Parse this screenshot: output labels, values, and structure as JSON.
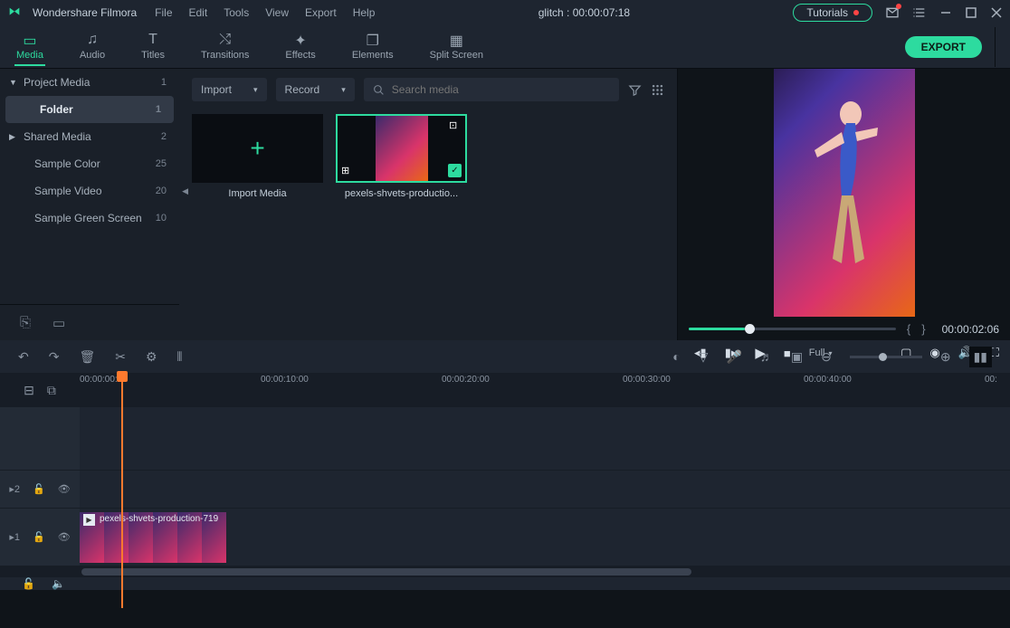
{
  "app_title": "Wondershare Filmora",
  "menu": [
    "File",
    "Edit",
    "Tools",
    "View",
    "Export",
    "Help"
  ],
  "project_title": "glitch : 00:00:07:18",
  "tutorials_label": "Tutorials",
  "tool_tabs": [
    {
      "label": "Media",
      "icon": "folder"
    },
    {
      "label": "Audio",
      "icon": "music"
    },
    {
      "label": "Titles",
      "icon": "text"
    },
    {
      "label": "Transitions",
      "icon": "trans"
    },
    {
      "label": "Effects",
      "icon": "fx"
    },
    {
      "label": "Elements",
      "icon": "elem"
    },
    {
      "label": "Split Screen",
      "icon": "split"
    }
  ],
  "export_label": "EXPORT",
  "sidebar_items": [
    {
      "label": "Project Media",
      "count": "1",
      "arrow": "▼",
      "indent": false
    },
    {
      "label": "Folder",
      "count": "1",
      "indent": true,
      "active": true
    },
    {
      "label": "Shared Media",
      "count": "2",
      "arrow": "▶",
      "indent": false
    },
    {
      "label": "Sample Color",
      "count": "25",
      "indent": true
    },
    {
      "label": "Sample Video",
      "count": "20",
      "indent": true
    },
    {
      "label": "Sample Green Screen",
      "count": "10",
      "indent": true
    }
  ],
  "import_label": "Import",
  "record_label": "Record",
  "search_placeholder": "Search media",
  "import_media_label": "Import Media",
  "media_clip_label": "pexels-shvets-productio...",
  "preview_timecode": "00:00:02:06",
  "quality_label": "Full",
  "timeline_labels": [
    "00:00:00:00",
    "00:00:10:00",
    "00:00:20:00",
    "00:00:30:00",
    "00:00:40:00",
    "00:"
  ],
  "clip_label": "pexels-shvets-production-719",
  "track_labels": {
    "v2": "2",
    "v1": "1"
  }
}
